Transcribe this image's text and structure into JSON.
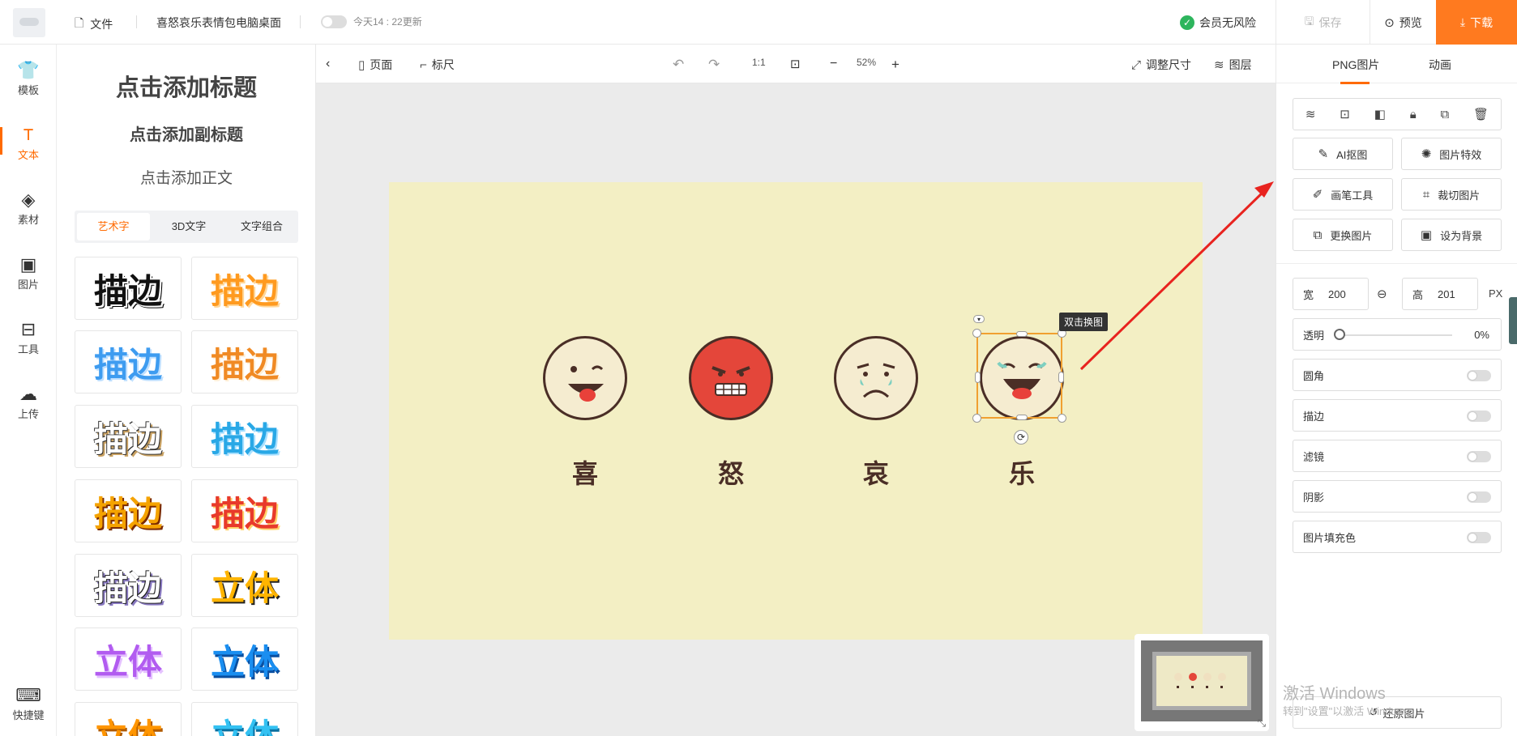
{
  "topbar": {
    "file_label": "文件",
    "doc_title": "喜怒哀乐表情包电脑桌面",
    "autosave_label": "今天14 : 22更新",
    "member_label": "会员无风险",
    "save_label": "保存",
    "preview_label": "预览",
    "download_label": "下载",
    "accent": "#ff7a1f"
  },
  "rail": {
    "items": [
      {
        "label": "模板",
        "icon": "tshirt-icon"
      },
      {
        "label": "文本",
        "icon": "text-icon"
      },
      {
        "label": "素材",
        "icon": "shapes-icon"
      },
      {
        "label": "图片",
        "icon": "image-icon"
      },
      {
        "label": "工具",
        "icon": "toolbox-icon"
      },
      {
        "label": "上传",
        "icon": "cloud-upload-icon"
      }
    ],
    "shortcut_label": "快捷键"
  },
  "text_panel": {
    "add_title": "点击添加标题",
    "add_subtitle": "点击添加副标题",
    "add_body": "点击添加正文",
    "tabs": [
      "艺术字",
      "3D文字",
      "文字组合"
    ],
    "tiles": [
      "描边",
      "描边",
      "描边",
      "描边",
      "描边",
      "描边",
      "描边",
      "描边",
      "描边",
      "立体",
      "立体",
      "立体",
      "立体",
      "立体"
    ]
  },
  "canvas_toolbar": {
    "page_label": "页面",
    "ruler_label": "标尺",
    "ratio_label": "1:1",
    "zoom": "52%",
    "resize_label": "调整尺寸",
    "layers_label": "图层"
  },
  "artboard": {
    "bg": "#f3efc4",
    "chars": [
      "喜",
      "怒",
      "哀",
      "乐"
    ],
    "tooltip": "双击换图"
  },
  "right_panel": {
    "tab_png": "PNG图片",
    "tab_anim": "动画",
    "buttons": [
      "AI抠图",
      "图片特效",
      "画笔工具",
      "裁切图片",
      "更换图片",
      "设为背景"
    ],
    "width_label": "宽",
    "width_value": "200",
    "height_label": "高",
    "height_value": "201",
    "unit": "PX",
    "opacity_label": "透明",
    "opacity_value": "0%",
    "toggles": [
      "圆角",
      "描边",
      "滤镜",
      "阴影",
      "图片填充色"
    ],
    "restore_label": "还原图片"
  },
  "watermark": {
    "line1": "激活 Windows",
    "line2": "转到\"设置\"以激活 Windows。"
  }
}
